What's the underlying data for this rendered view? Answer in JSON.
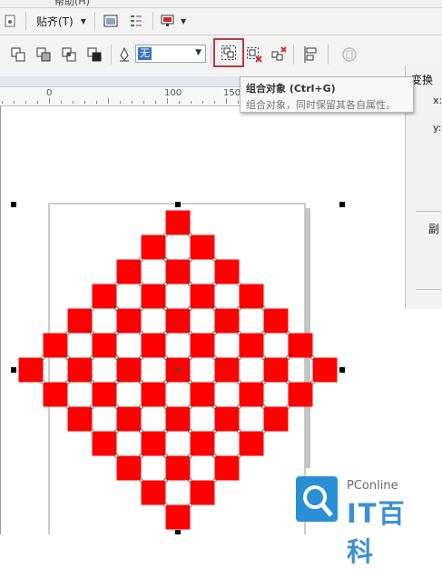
{
  "menu": {
    "partial_label": "帮助(H)"
  },
  "toolbar1": {
    "snap_label": "贴齐(T)"
  },
  "toolbar2": {
    "outline_value": "无",
    "buttons": [
      {
        "name": "weld-icon"
      },
      {
        "name": "trim-icon"
      },
      {
        "name": "intersect-icon"
      },
      {
        "name": "simplify-icon"
      },
      {
        "name": "group-objects-icon"
      },
      {
        "name": "ungroup-icon"
      },
      {
        "name": "ungroup-all-icon"
      },
      {
        "name": "align-distribute-icon"
      },
      {
        "name": "lock-icon"
      }
    ]
  },
  "ruler": {
    "labels": [
      "0",
      "100",
      "150"
    ]
  },
  "tooltip": {
    "title": "组合对象 (Ctrl+G)",
    "description": "组合对象，同时保留其各自属性。"
  },
  "panel": {
    "title": "变换",
    "x_label": "x:",
    "y_label": "y:",
    "copies_label": "副"
  },
  "canvas": {
    "pattern": "red-white-diamond-checkerboard",
    "fill_color": "#ff0000",
    "selection_handle_color": "#000000",
    "center_marker": "×"
  },
  "watermark": {
    "line1": "PConline",
    "line2": "IT百科"
  }
}
